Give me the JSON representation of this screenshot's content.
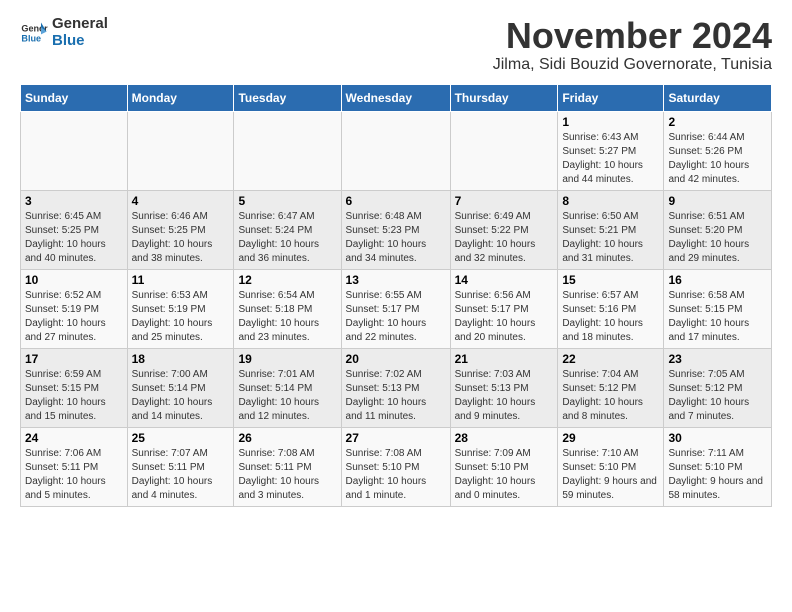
{
  "header": {
    "logo_general": "General",
    "logo_blue": "Blue",
    "main_title": "November 2024",
    "subtitle": "Jilma, Sidi Bouzid Governorate, Tunisia"
  },
  "calendar": {
    "days_of_week": [
      "Sunday",
      "Monday",
      "Tuesday",
      "Wednesday",
      "Thursday",
      "Friday",
      "Saturday"
    ],
    "weeks": [
      [
        {
          "day": "",
          "info": ""
        },
        {
          "day": "",
          "info": ""
        },
        {
          "day": "",
          "info": ""
        },
        {
          "day": "",
          "info": ""
        },
        {
          "day": "",
          "info": ""
        },
        {
          "day": "1",
          "info": "Sunrise: 6:43 AM\nSunset: 5:27 PM\nDaylight: 10 hours and 44 minutes."
        },
        {
          "day": "2",
          "info": "Sunrise: 6:44 AM\nSunset: 5:26 PM\nDaylight: 10 hours and 42 minutes."
        }
      ],
      [
        {
          "day": "3",
          "info": "Sunrise: 6:45 AM\nSunset: 5:25 PM\nDaylight: 10 hours and 40 minutes."
        },
        {
          "day": "4",
          "info": "Sunrise: 6:46 AM\nSunset: 5:25 PM\nDaylight: 10 hours and 38 minutes."
        },
        {
          "day": "5",
          "info": "Sunrise: 6:47 AM\nSunset: 5:24 PM\nDaylight: 10 hours and 36 minutes."
        },
        {
          "day": "6",
          "info": "Sunrise: 6:48 AM\nSunset: 5:23 PM\nDaylight: 10 hours and 34 minutes."
        },
        {
          "day": "7",
          "info": "Sunrise: 6:49 AM\nSunset: 5:22 PM\nDaylight: 10 hours and 32 minutes."
        },
        {
          "day": "8",
          "info": "Sunrise: 6:50 AM\nSunset: 5:21 PM\nDaylight: 10 hours and 31 minutes."
        },
        {
          "day": "9",
          "info": "Sunrise: 6:51 AM\nSunset: 5:20 PM\nDaylight: 10 hours and 29 minutes."
        }
      ],
      [
        {
          "day": "10",
          "info": "Sunrise: 6:52 AM\nSunset: 5:19 PM\nDaylight: 10 hours and 27 minutes."
        },
        {
          "day": "11",
          "info": "Sunrise: 6:53 AM\nSunset: 5:19 PM\nDaylight: 10 hours and 25 minutes."
        },
        {
          "day": "12",
          "info": "Sunrise: 6:54 AM\nSunset: 5:18 PM\nDaylight: 10 hours and 23 minutes."
        },
        {
          "day": "13",
          "info": "Sunrise: 6:55 AM\nSunset: 5:17 PM\nDaylight: 10 hours and 22 minutes."
        },
        {
          "day": "14",
          "info": "Sunrise: 6:56 AM\nSunset: 5:17 PM\nDaylight: 10 hours and 20 minutes."
        },
        {
          "day": "15",
          "info": "Sunrise: 6:57 AM\nSunset: 5:16 PM\nDaylight: 10 hours and 18 minutes."
        },
        {
          "day": "16",
          "info": "Sunrise: 6:58 AM\nSunset: 5:15 PM\nDaylight: 10 hours and 17 minutes."
        }
      ],
      [
        {
          "day": "17",
          "info": "Sunrise: 6:59 AM\nSunset: 5:15 PM\nDaylight: 10 hours and 15 minutes."
        },
        {
          "day": "18",
          "info": "Sunrise: 7:00 AM\nSunset: 5:14 PM\nDaylight: 10 hours and 14 minutes."
        },
        {
          "day": "19",
          "info": "Sunrise: 7:01 AM\nSunset: 5:14 PM\nDaylight: 10 hours and 12 minutes."
        },
        {
          "day": "20",
          "info": "Sunrise: 7:02 AM\nSunset: 5:13 PM\nDaylight: 10 hours and 11 minutes."
        },
        {
          "day": "21",
          "info": "Sunrise: 7:03 AM\nSunset: 5:13 PM\nDaylight: 10 hours and 9 minutes."
        },
        {
          "day": "22",
          "info": "Sunrise: 7:04 AM\nSunset: 5:12 PM\nDaylight: 10 hours and 8 minutes."
        },
        {
          "day": "23",
          "info": "Sunrise: 7:05 AM\nSunset: 5:12 PM\nDaylight: 10 hours and 7 minutes."
        }
      ],
      [
        {
          "day": "24",
          "info": "Sunrise: 7:06 AM\nSunset: 5:11 PM\nDaylight: 10 hours and 5 minutes."
        },
        {
          "day": "25",
          "info": "Sunrise: 7:07 AM\nSunset: 5:11 PM\nDaylight: 10 hours and 4 minutes."
        },
        {
          "day": "26",
          "info": "Sunrise: 7:08 AM\nSunset: 5:11 PM\nDaylight: 10 hours and 3 minutes."
        },
        {
          "day": "27",
          "info": "Sunrise: 7:08 AM\nSunset: 5:10 PM\nDaylight: 10 hours and 1 minute."
        },
        {
          "day": "28",
          "info": "Sunrise: 7:09 AM\nSunset: 5:10 PM\nDaylight: 10 hours and 0 minutes."
        },
        {
          "day": "29",
          "info": "Sunrise: 7:10 AM\nSunset: 5:10 PM\nDaylight: 9 hours and 59 minutes."
        },
        {
          "day": "30",
          "info": "Sunrise: 7:11 AM\nSunset: 5:10 PM\nDaylight: 9 hours and 58 minutes."
        }
      ]
    ]
  }
}
